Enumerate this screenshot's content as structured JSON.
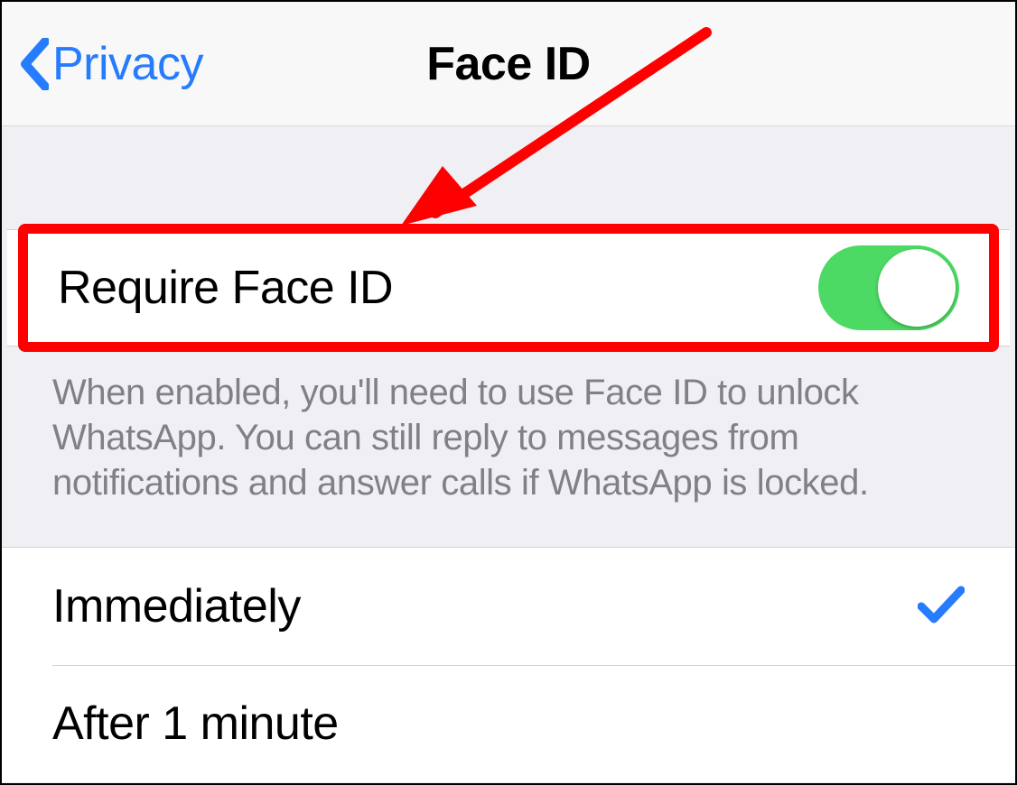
{
  "nav": {
    "back_label": "Privacy",
    "title": "Face ID"
  },
  "toggle_row": {
    "label": "Require Face ID",
    "enabled": true
  },
  "footer": {
    "text": "When enabled, you'll need to use Face ID to unlock WhatsApp. You can still reply to messages from notifications and answer calls if WhatsApp is locked."
  },
  "options": [
    {
      "label": "Immediately",
      "selected": true
    },
    {
      "label": "After 1 minute",
      "selected": false
    }
  ],
  "colors": {
    "ios_blue": "#267cfd",
    "switch_green": "#4cd964",
    "highlight_red": "#ff0000",
    "arrow_red": "#ff0000"
  }
}
